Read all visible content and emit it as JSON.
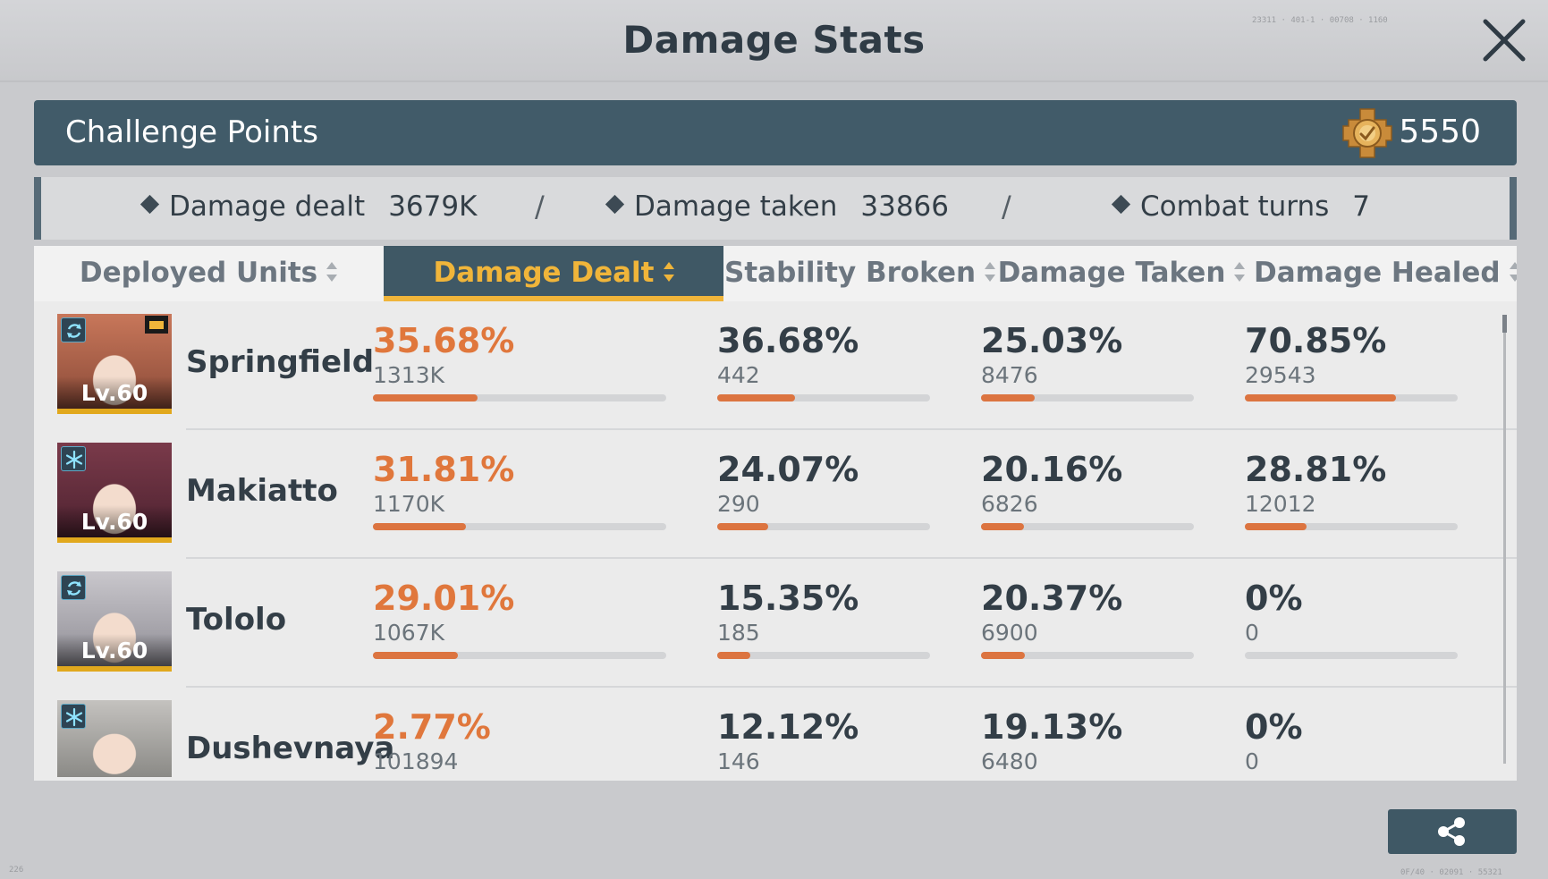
{
  "header": {
    "title": "Damage Stats"
  },
  "deco": {
    "top_right": "23311 · 401-1 · 00708 · 1160",
    "bottom_left": "226",
    "bottom_right": "0F/40 · 02091 · 55321"
  },
  "challenge": {
    "label": "Challenge Points",
    "value": "5550",
    "icon": "challenge-medal-icon"
  },
  "summary": [
    {
      "label": "Damage dealt",
      "value": "3679K"
    },
    {
      "label": "Damage taken",
      "value": "33866"
    },
    {
      "label": "Combat turns",
      "value": "7"
    }
  ],
  "separator": "/",
  "columns": [
    {
      "label": "Deployed Units",
      "active": false
    },
    {
      "label": "Damage Dealt",
      "active": true
    },
    {
      "label": "Stability Broken",
      "active": false
    },
    {
      "label": "Damage Taken",
      "active": false
    },
    {
      "label": "Damage Healed",
      "active": false
    }
  ],
  "units": [
    {
      "name": "Springfield",
      "level": "Lv.60",
      "badge_icon": "cycle-icon",
      "stats": [
        {
          "pct": "35.68%",
          "raw": "1313K",
          "fraction": 0.357
        },
        {
          "pct": "36.68%",
          "raw": "442",
          "fraction": 0.367
        },
        {
          "pct": "25.03%",
          "raw": "8476",
          "fraction": 0.25
        },
        {
          "pct": "70.85%",
          "raw": "29543",
          "fraction": 0.709
        }
      ]
    },
    {
      "name": "Makiatto",
      "level": "Lv.60",
      "badge_icon": "snowflake-icon",
      "stats": [
        {
          "pct": "31.81%",
          "raw": "1170K",
          "fraction": 0.318
        },
        {
          "pct": "24.07%",
          "raw": "290",
          "fraction": 0.241
        },
        {
          "pct": "20.16%",
          "raw": "6826",
          "fraction": 0.202
        },
        {
          "pct": "28.81%",
          "raw": "12012",
          "fraction": 0.288
        }
      ]
    },
    {
      "name": "Tololo",
      "level": "Lv.60",
      "badge_icon": "cycle-icon",
      "stats": [
        {
          "pct": "29.01%",
          "raw": "1067K",
          "fraction": 0.29
        },
        {
          "pct": "15.35%",
          "raw": "185",
          "fraction": 0.154
        },
        {
          "pct": "20.37%",
          "raw": "6900",
          "fraction": 0.204
        },
        {
          "pct": "0%",
          "raw": "0",
          "fraction": 0
        }
      ]
    },
    {
      "name": "Dushevnaya",
      "level": "",
      "badge_icon": "snowflake-icon",
      "stats": [
        {
          "pct": "2.77%",
          "raw": "101894",
          "fraction": 0.028
        },
        {
          "pct": "12.12%",
          "raw": "146",
          "fraction": 0.121
        },
        {
          "pct": "19.13%",
          "raw": "6480",
          "fraction": 0.191
        },
        {
          "pct": "0%",
          "raw": "0",
          "fraction": 0
        }
      ]
    }
  ],
  "colors": {
    "accent": "#f0b53a",
    "bar_fill": "#dc7440",
    "highlight_text": "#e0773c",
    "header_bg": "#415b69"
  },
  "share": {
    "icon": "share-icon"
  }
}
